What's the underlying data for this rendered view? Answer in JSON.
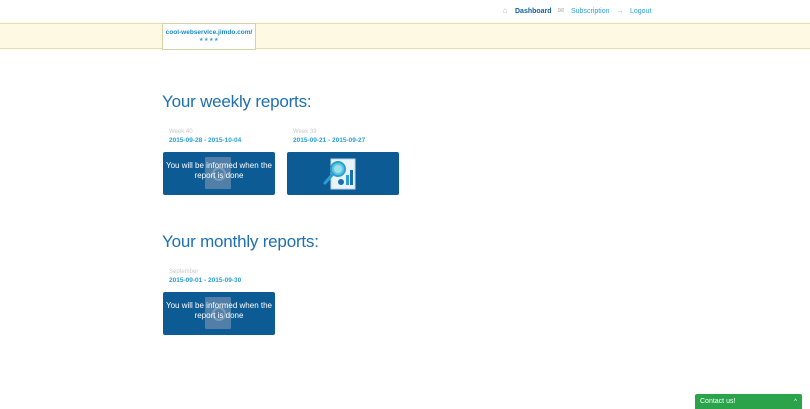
{
  "nav": {
    "dashboard": "Dashboard",
    "subscription": "Subscription",
    "logout": "Logout"
  },
  "site": {
    "url": "cool-webservice.jimdo.com/",
    "stars": "★★★★"
  },
  "weekly": {
    "title": "Your weekly reports:",
    "reports": [
      {
        "week": "Week 40",
        "range": "2015-09-28 - 2015-10-04",
        "status_text": "You will be informed when the report is done"
      },
      {
        "week": "Week 39",
        "range": "2015-09-21 - 2015-09-27",
        "status_text": ""
      }
    ]
  },
  "monthly": {
    "title": "Your monthly reports:",
    "reports": [
      {
        "month": "September",
        "range": "2015-09-01 - 2015-09-30",
        "status_text": "You will be informed when the report is done"
      }
    ]
  },
  "contact": {
    "label": "Contact us!",
    "chevron": "^"
  }
}
